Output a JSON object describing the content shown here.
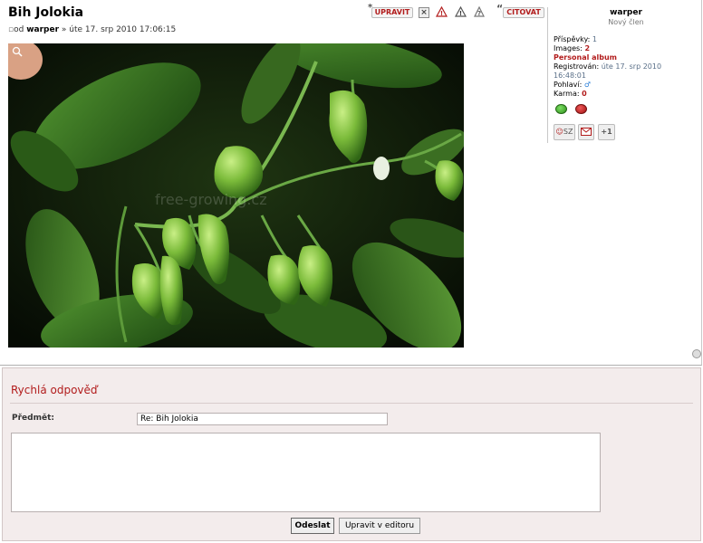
{
  "post": {
    "title": "Bih Jolokia",
    "author_prefix": "od",
    "author": "warper",
    "separator": "»",
    "date": "úte 17. srp 2010 17:06:15",
    "buttons": {
      "edit": "UPRAVIT",
      "delete": "×",
      "report": "!",
      "warn": "!",
      "info": "?",
      "quote": "CITOVAT"
    },
    "image": {
      "description_icon": "zoom-icon",
      "watermark": "free-growing.cz"
    }
  },
  "profile": {
    "username": "warper",
    "rank": "Nový člen",
    "posts_label": "Příspěvky:",
    "posts_value": "1",
    "images_label": "Images:",
    "images_value": "2",
    "album_link": "Personal album",
    "registered_label": "Registrován:",
    "registered_value_1": "úte 17. srp 2010",
    "registered_value_2": "16:48:01",
    "gender_label": "Pohlaví:",
    "gender_icon": "male-icon",
    "karma_label": "Karma:",
    "karma_value": "0",
    "contact_pm": "SZ",
    "contact_plus": "+1"
  },
  "quick_reply": {
    "title": "Rychlá odpověď",
    "subject_label": "Předmět:",
    "subject_value": "Re: Bih Jolokia",
    "message_value": "",
    "send_label": "Odeslat",
    "full_editor_label": "Upravit v editoru"
  },
  "colors": {
    "accent_red": "#b21c1c",
    "quick_reply_bg": "#f3ecec",
    "info_blue": "#5a6f88"
  }
}
